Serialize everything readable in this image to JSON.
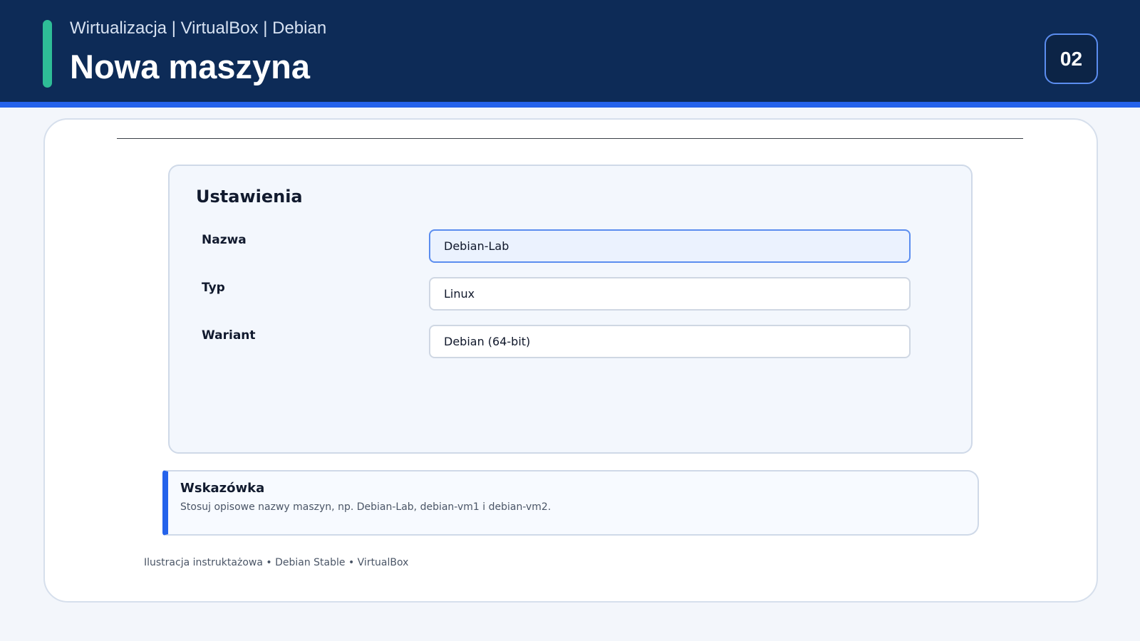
{
  "header": {
    "subtitle": "Wirtualizacja | VirtualBox | Debian",
    "title": "Nowa maszyna",
    "slide_number": "02"
  },
  "colors": {
    "header_bg": "#0d2b57",
    "accent_green": "#2ebd97",
    "accent_blue": "#2563eb",
    "active_field_border": "#5b8def"
  },
  "settings": {
    "title": "Ustawienia",
    "fields": [
      {
        "label": "Nazwa",
        "value": "Debian-Lab",
        "active": true
      },
      {
        "label": "Typ",
        "value": "Linux",
        "active": false
      },
      {
        "label": "Wariant",
        "value": "Debian (64-bit)",
        "active": false
      }
    ]
  },
  "tip": {
    "title": "Wskazówka",
    "text": "Stosuj opisowe nazwy maszyn, np. Debian-Lab, debian-vm1 i debian-vm2."
  },
  "footer": {
    "text": "Ilustracja instruktażowa • Debian Stable • VirtualBox"
  }
}
